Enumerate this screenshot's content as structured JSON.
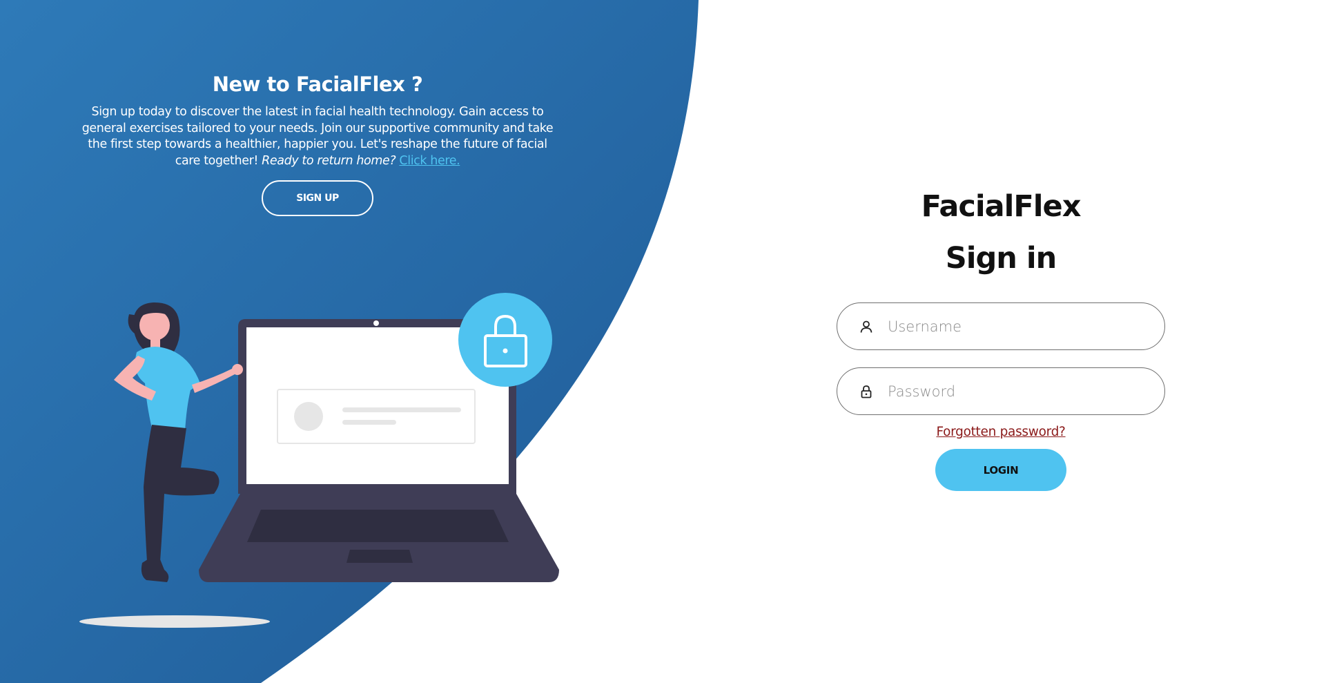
{
  "colors": {
    "blue_dark": "#1f5a96",
    "blue_light": "#2e7ab8",
    "accent": "#4fc3f0",
    "laptop": "#3f3d56",
    "forgot_link": "#8b1a1a"
  },
  "left": {
    "title": "New to FacialFlex ?",
    "description": "Sign up today to discover the latest in facial health technology. Gain access to general exercises tailored to your needs. Join our supportive community and take the first step towards a healthier, happier you. Let's reshape the future of facial care together!",
    "return_text": "Ready to return home?",
    "return_link": "Click here.",
    "signup_label": "SIGN UP"
  },
  "illustration": {
    "icons": [
      "woman-figure",
      "laptop",
      "lock-icon"
    ]
  },
  "right": {
    "brand": "FacialFlex",
    "title": "Sign in",
    "username": {
      "placeholder": "Username",
      "value": "",
      "icon": "user-icon"
    },
    "password": {
      "placeholder": "Password",
      "value": "",
      "icon": "lock-icon"
    },
    "forgot_label": "Forgotten password?",
    "login_label": "LOGIN"
  }
}
